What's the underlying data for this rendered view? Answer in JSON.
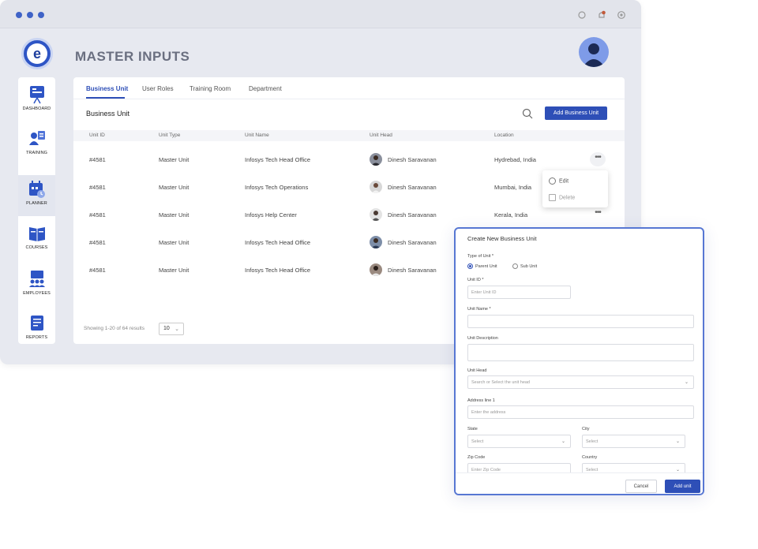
{
  "header": {
    "title": "MASTER INPUTS",
    "logo_letter": "e"
  },
  "sidebar": {
    "items": [
      {
        "label": "DASHBOARD",
        "icon": "dashboard-icon"
      },
      {
        "label": "TRAINING",
        "icon": "training-icon"
      },
      {
        "label": "PLANNER",
        "icon": "planner-icon",
        "active": true
      },
      {
        "label": "COURSES",
        "icon": "courses-icon"
      },
      {
        "label": "EMPLOYEES",
        "icon": "employees-icon"
      },
      {
        "label": "REPORTS",
        "icon": "reports-icon"
      }
    ]
  },
  "tabs": [
    {
      "label": "Business Unit",
      "active": true
    },
    {
      "label": "User Roles"
    },
    {
      "label": "Training Room"
    },
    {
      "label": "Department"
    }
  ],
  "section": {
    "title": "Business Unit",
    "add_button": "Add Business Unit"
  },
  "table": {
    "columns": [
      "Unit ID",
      "Unit Type",
      "Unit Name",
      "Unit Head",
      "Location"
    ],
    "rows": [
      {
        "id": "#4581",
        "type": "Master Unit",
        "name": "Infosys Tech Head Office",
        "head": "Dinesh Saravanan",
        "location": "Hydrebad, India"
      },
      {
        "id": "#4581",
        "type": "Master Unit",
        "name": "Infosys Tech Operations",
        "head": "Dinesh Saravanan",
        "location": "Mumbai, India"
      },
      {
        "id": "#4581",
        "type": "Master Unit",
        "name": "Infosys Help Center",
        "head": "Dinesh Saravanan",
        "location": "Kerala, India"
      },
      {
        "id": "#4581",
        "type": "Master Unit",
        "name": "Infosys Tech Head Office",
        "head": "Dinesh Saravanan",
        "location": ""
      },
      {
        "id": "#4581",
        "type": "Master Unit",
        "name": "Infosys Tech Head Office",
        "head": "Dinesh Saravanan",
        "location": ""
      }
    ],
    "more_glyph": "•••"
  },
  "row_menu": {
    "edit": "Edit",
    "delete": "Delete"
  },
  "pagination": {
    "summary": "Showing 1-20 of 64 results",
    "page_size": "10"
  },
  "modal": {
    "title": "Create New Business Unit",
    "type_label": "Type of Unit *",
    "type_options": [
      "Parent Unit",
      "Sub Unit"
    ],
    "unit_id_label": "Unit ID *",
    "unit_id_placeholder": "Enter Unit ID",
    "unit_name_label": "Unit Name *",
    "unit_desc_label": "Unit Description",
    "unit_head_label": "Unit Head",
    "unit_head_placeholder": "Search or Select the unit head",
    "address_label": "Address line 1",
    "address_placeholder": "Enter the address",
    "state_label": "State",
    "state_placeholder": "Select",
    "city_label": "City",
    "city_placeholder": "Select",
    "zip_label": "Zip Code",
    "zip_placeholder": "Enter Zip Code",
    "country_label": "Country",
    "country_placeholder": "Select",
    "cancel": "Cancel",
    "submit": "Add unit"
  },
  "colors": {
    "accent": "#2e4fb7",
    "window_bg": "#e7e9f0",
    "modal_border": "#5777d3"
  }
}
